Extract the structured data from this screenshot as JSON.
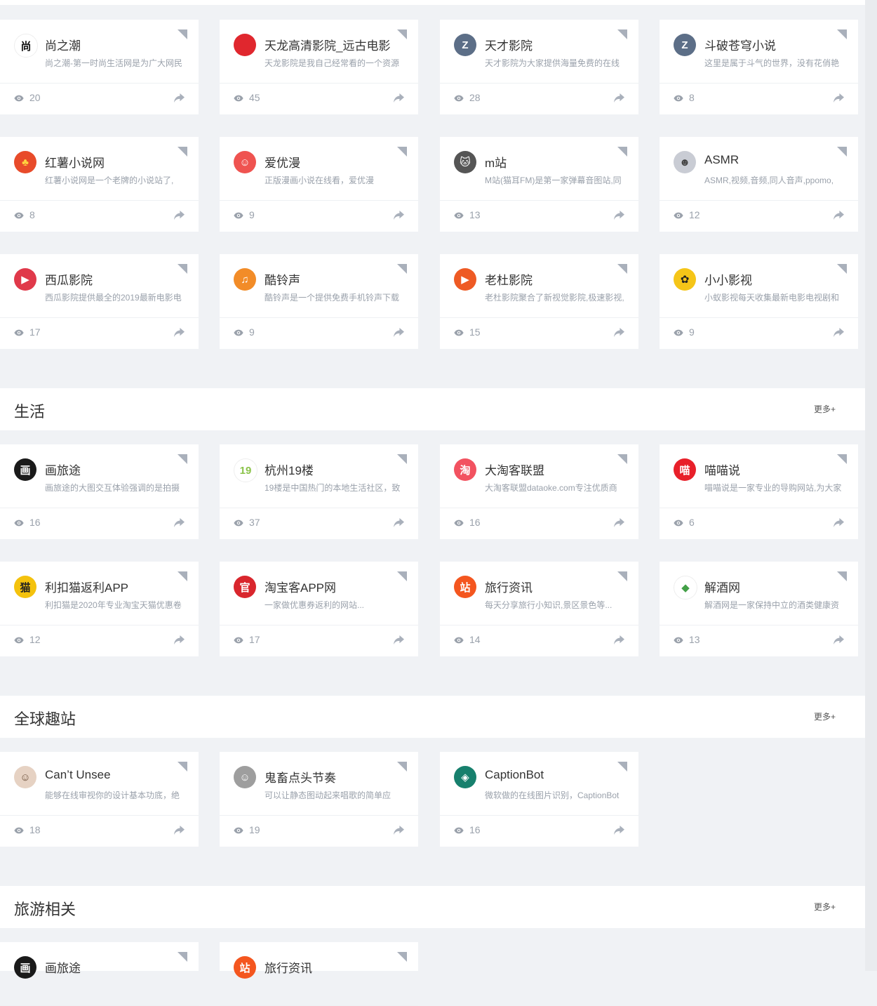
{
  "colors": {
    "background": "#f0f2f5",
    "card": "#ffffff",
    "muted": "#9aa1ab",
    "title": "#333333"
  },
  "groups": [
    {
      "title": "",
      "more": "",
      "cards": [
        {
          "name": "尚之潮",
          "desc": "尚之潮-第一时尚生活网是为广大网民",
          "views": "20",
          "logo_text": "尚",
          "logo_bg": "#ffffff",
          "logo_fg": "#111111",
          "logo_icon": "shang-logo-icon"
        },
        {
          "name": "天龙高清影院_远古电影",
          "desc": "天龙影院是我自己经常看的一个资源",
          "views": "45",
          "logo_text": "",
          "logo_bg": "#e0272e",
          "logo_fg": "#ffffff",
          "logo_icon": "tianlong-logo-icon"
        },
        {
          "name": "天才影院",
          "desc": "天才影院为大家提供海量免费的在线",
          "views": "28",
          "logo_text": "Z",
          "logo_bg": "#5c6e87",
          "logo_fg": "#ffffff",
          "logo_icon": "tiancai-logo-icon"
        },
        {
          "name": "斗破苍穹小说",
          "desc": "这里是属于斗气的世界，没有花俏艳",
          "views": "8",
          "logo_text": "Z",
          "logo_bg": "#5c6e87",
          "logo_fg": "#ffffff",
          "logo_icon": "doupo-logo-icon"
        },
        {
          "name": "红薯小说网",
          "desc": "红薯小说网是一个老牌的小说站了,",
          "views": "8",
          "logo_text": "♣",
          "logo_bg": "#e84b2a",
          "logo_fg": "#ffd23f",
          "logo_icon": "hongshu-logo-icon"
        },
        {
          "name": "爱优漫",
          "desc": "正版漫画小说在线看，爱优漫",
          "views": "9",
          "logo_text": "☺",
          "logo_bg": "#ef5350",
          "logo_fg": "#ffffff",
          "logo_icon": "aiyouman-logo-icon"
        },
        {
          "name": "m站",
          "desc": "M站(猫耳FM)是第一家弹幕音图站,同",
          "views": "13",
          "logo_text": "🐱",
          "logo_bg": "#555555",
          "logo_fg": "#ffffff",
          "logo_icon": "maoer-logo-icon"
        },
        {
          "name": "ASMR",
          "desc": "ASMR,视频,音频,同人音声,ppomo,",
          "views": "12",
          "logo_text": "☻",
          "logo_bg": "#c9ccd4",
          "logo_fg": "#444444",
          "logo_icon": "asmr-logo-icon"
        },
        {
          "name": "西瓜影院",
          "desc": "西瓜影院提供最全的2019最新电影电",
          "views": "17",
          "logo_text": "▶",
          "logo_bg": "#e0394a",
          "logo_fg": "#ffffff",
          "logo_icon": "xigua-logo-icon"
        },
        {
          "name": "酷铃声",
          "desc": "酷铃声是一个提供免费手机铃声下载",
          "views": "9",
          "logo_text": "♫",
          "logo_bg": "#f28c28",
          "logo_fg": "#ffffff",
          "logo_icon": "kulingsheng-logo-icon"
        },
        {
          "name": "老杜影院",
          "desc": "老杜影院聚合了新视觉影院,极速影视,",
          "views": "15",
          "logo_text": "▶",
          "logo_bg": "#ee5a24",
          "logo_fg": "#ffffff",
          "logo_icon": "laodu-logo-icon"
        },
        {
          "name": "小小影视",
          "desc": "小蚁影视每天收集最新电影电视剧和",
          "views": "9",
          "logo_text": "✿",
          "logo_bg": "#f5c518",
          "logo_fg": "#222222",
          "logo_icon": "xiaoxiao-logo-icon"
        }
      ]
    },
    {
      "title": "生活",
      "more": "更多+",
      "cards": [
        {
          "name": "画旅途",
          "desc": "画旅途的大图交互体验强调的是拍摄",
          "views": "16",
          "logo_text": "画",
          "logo_bg": "#1a1a1a",
          "logo_fg": "#ffffff",
          "logo_icon": "hualvtu-logo-icon"
        },
        {
          "name": "杭州19楼",
          "desc": "19楼是中国热门的本地生活社区，致",
          "views": "37",
          "logo_text": "19",
          "logo_bg": "#ffffff",
          "logo_fg": "#8bc34a",
          "logo_icon": "hz19lou-logo-icon"
        },
        {
          "name": "大淘客联盟",
          "desc": "大淘客联盟dataoke.com专注优质商",
          "views": "16",
          "logo_text": "淘",
          "logo_bg": "#f25260",
          "logo_fg": "#ffffff",
          "logo_icon": "dataoke-logo-icon"
        },
        {
          "name": "喵喵说",
          "desc": "喵喵说是一家专业的导购网站,为大家",
          "views": "6",
          "logo_text": "喵",
          "logo_bg": "#e8202a",
          "logo_fg": "#ffffff",
          "logo_icon": "miaomiao-logo-icon"
        },
        {
          "name": "利扣猫返利APP",
          "desc": "利扣猫是2020年专业淘宝天猫优惠卷",
          "views": "12",
          "logo_text": "猫",
          "logo_bg": "#f4c20d",
          "logo_fg": "#222222",
          "logo_icon": "likoumao-logo-icon"
        },
        {
          "name": "淘宝客APP网",
          "desc": "一家做优惠券返利的网站...",
          "views": "17",
          "logo_text": "官",
          "logo_bg": "#d9262d",
          "logo_fg": "#ffffff",
          "logo_icon": "taobaoke-logo-icon"
        },
        {
          "name": "旅行资讯",
          "desc": "每天分享旅行小知识,景区景色等...",
          "views": "14",
          "logo_text": "站",
          "logo_bg": "#f4561f",
          "logo_fg": "#ffffff",
          "logo_icon": "lvxing-logo-icon"
        },
        {
          "name": "解酒网",
          "desc": "解酒网是一家保持中立的酒类健康资",
          "views": "13",
          "logo_text": "◆",
          "logo_bg": "#ffffff",
          "logo_fg": "#43a047",
          "logo_icon": "jiejiu-logo-icon"
        }
      ]
    },
    {
      "title": "全球趣站",
      "more": "更多+",
      "cards": [
        {
          "name": "Can’t Unsee",
          "desc": "能够在线审视你的设计基本功底，绝",
          "views": "18",
          "logo_text": "☺",
          "logo_bg": "#e6d2c3",
          "logo_fg": "#6b4f3a",
          "logo_icon": "cantunsee-logo-icon"
        },
        {
          "name": "鬼畜点头节奏",
          "desc": "可以让静态图动起来唱歌的简单应",
          "views": "19",
          "logo_text": "☺",
          "logo_bg": "#9e9e9e",
          "logo_fg": "#ffffff",
          "logo_icon": "guichu-logo-icon"
        },
        {
          "name": "CaptionBot",
          "desc": "微软做的在线图片识别，CaptionBot",
          "views": "16",
          "logo_text": "◈",
          "logo_bg": "#17806d",
          "logo_fg": "#ffffff",
          "logo_icon": "captionbot-logo-icon"
        }
      ]
    },
    {
      "title": "旅游相关",
      "more": "更多+",
      "cards": [
        {
          "name": "画旅途",
          "desc": "",
          "views": "",
          "logo_text": "画",
          "logo_bg": "#1a1a1a",
          "logo_fg": "#ffffff",
          "logo_icon": "hualvtu-logo-icon"
        },
        {
          "name": "旅行资讯",
          "desc": "",
          "views": "",
          "logo_text": "站",
          "logo_bg": "#f4561f",
          "logo_fg": "#ffffff",
          "logo_icon": "lvxing-logo-icon"
        }
      ]
    }
  ]
}
